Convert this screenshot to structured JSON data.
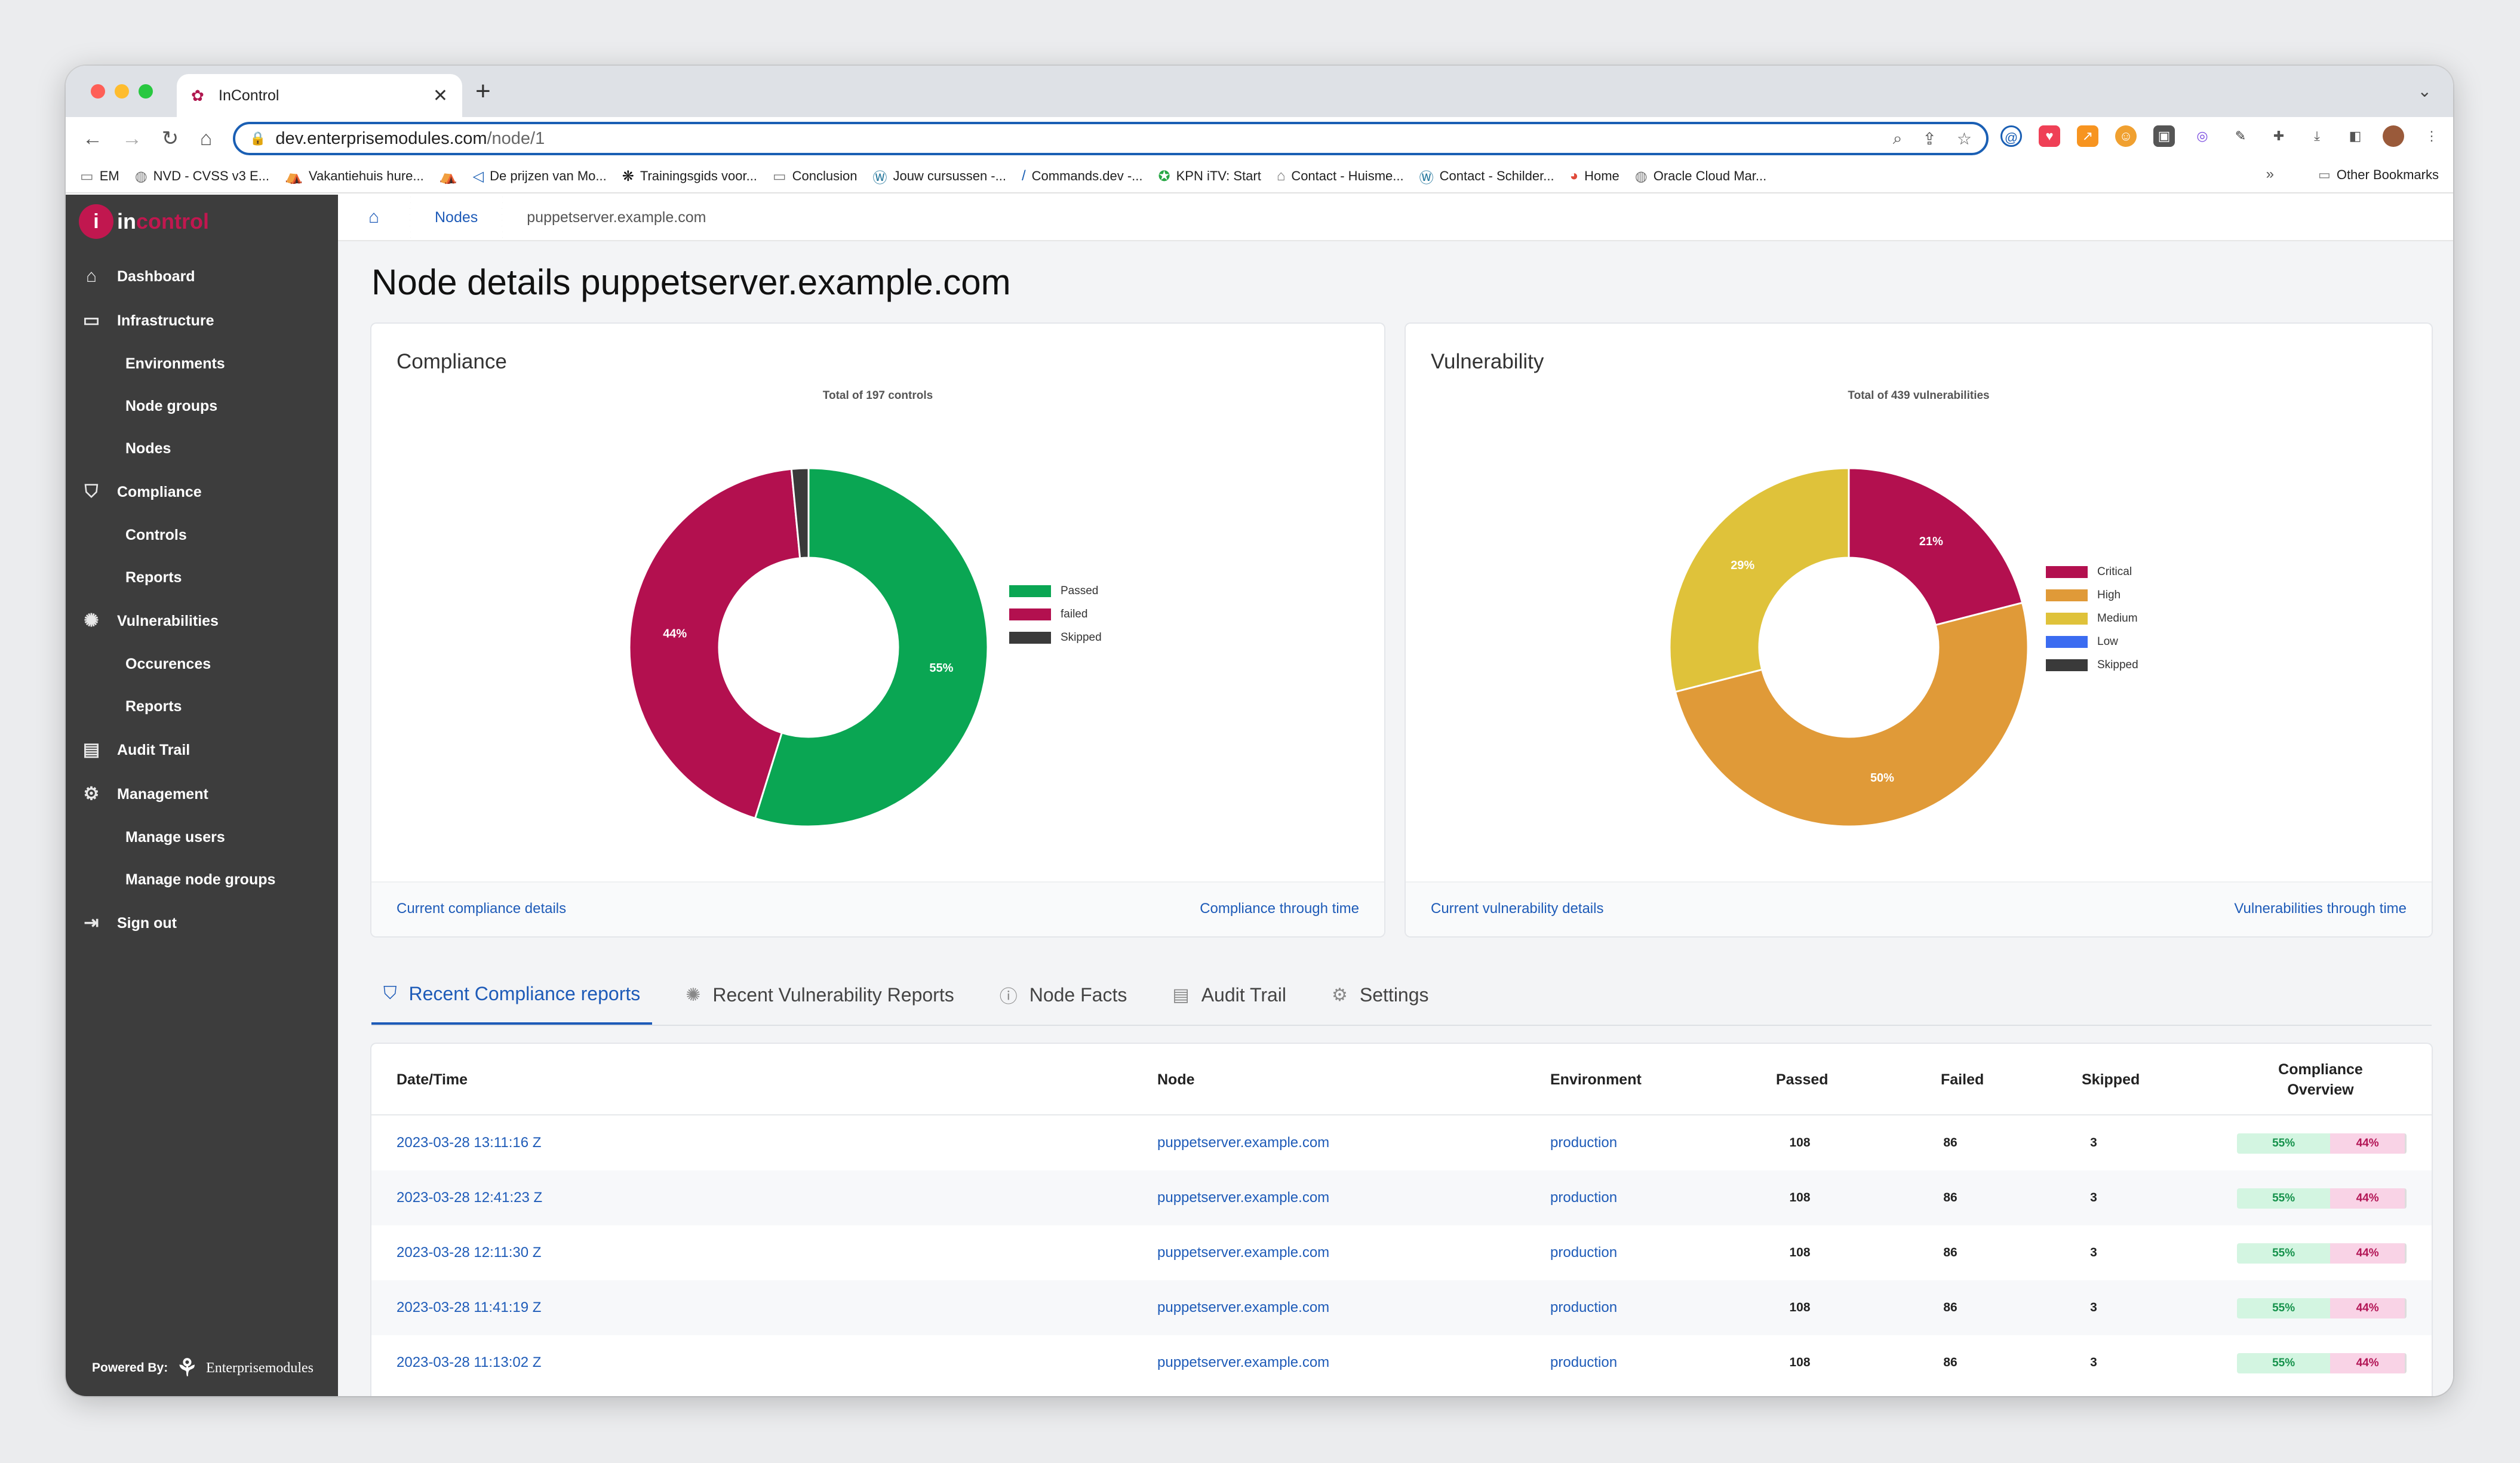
{
  "browser": {
    "tab_title": "InControl",
    "url_host": "dev.enterprisemodules.com",
    "url_path": "/node/1",
    "bookmarks": [
      "EM",
      "NVD - CVSS v3 E...",
      "Vakantiehuis hure...",
      "",
      "De prijzen van Mo...",
      "Trainingsgids voor...",
      "Conclusion",
      "Jouw cursussen -...",
      "Commands.dev -...",
      "KPN iTV: Start",
      "Contact - Huisme...",
      "Contact - Schilder...",
      "Home",
      "Oracle Cloud Mar..."
    ],
    "bookmarks_more": "»",
    "other_bookmarks": "Other Bookmarks"
  },
  "app": {
    "logo_in": "in",
    "logo_rest": "control",
    "nav": {
      "dashboard": "Dashboard",
      "infrastructure": "Infrastructure",
      "environments": "Environments",
      "node_groups": "Node groups",
      "nodes": "Nodes",
      "compliance": "Compliance",
      "controls": "Controls",
      "compliance_reports": "Reports",
      "vulnerabilities": "Vulnerabilities",
      "occurences": "Occurences",
      "vulnerability_reports": "Reports",
      "audit_trail": "Audit Trail",
      "management": "Management",
      "manage_users": "Manage users",
      "manage_node_groups": "Manage node groups",
      "sign_out": "Sign out"
    },
    "powered_by": "Powered By:",
    "powered_brand": "Enterprisemodules"
  },
  "breadcrumb": {
    "nodes": "Nodes",
    "current": "puppetserver.example.com"
  },
  "page_title": "Node details puppetserver.example.com",
  "compliance_card": {
    "title": "Compliance",
    "footer_left": "Current compliance details",
    "footer_right": "Compliance through time"
  },
  "vulnerability_card": {
    "title": "Vulnerability",
    "footer_left": "Current vulnerability details",
    "footer_right": "Vulnerabilities through time"
  },
  "chart_data": [
    {
      "type": "pie",
      "title": "Total of 197 controls",
      "categories": [
        "Passed",
        "failed",
        "Skipped"
      ],
      "values": [
        108,
        86,
        3
      ],
      "labels": [
        "55%",
        "44%",
        ""
      ],
      "colors": [
        "#0aa653",
        "#b3104f",
        "#3a3a3a"
      ],
      "legend": "right"
    },
    {
      "type": "pie",
      "title": "Total of 439 vulnerabilities",
      "categories": [
        "Critical",
        "High",
        "Medium",
        "Low",
        "Skipped"
      ],
      "values": [
        21,
        50,
        29,
        0,
        0
      ],
      "labels": [
        "21%",
        "50%",
        "29%",
        "",
        ""
      ],
      "colors": [
        "#b3104f",
        "#e09a38",
        "#dfc23a",
        "#3b6cf1",
        "#3a3a3a"
      ],
      "legend": "right"
    }
  ],
  "tabs": [
    "Recent Compliance reports",
    "Recent Vulnerability Reports",
    "Node Facts",
    "Audit Trail",
    "Settings"
  ],
  "table": {
    "headers": {
      "datetime": "Date/Time",
      "node": "Node",
      "environment": "Environment",
      "passed": "Passed",
      "failed": "Failed",
      "skipped": "Skipped",
      "overview_1": "Compliance",
      "overview_2": "Overview"
    },
    "rows": [
      {
        "datetime": "2023-03-28 13:11:16 Z",
        "node": "puppetserver.example.com",
        "environment": "production",
        "passed": "108",
        "failed": "86",
        "skipped": "3",
        "pct_passed": "55%",
        "pct_failed": "44%"
      },
      {
        "datetime": "2023-03-28 12:41:23 Z",
        "node": "puppetserver.example.com",
        "environment": "production",
        "passed": "108",
        "failed": "86",
        "skipped": "3",
        "pct_passed": "55%",
        "pct_failed": "44%"
      },
      {
        "datetime": "2023-03-28 12:11:30 Z",
        "node": "puppetserver.example.com",
        "environment": "production",
        "passed": "108",
        "failed": "86",
        "skipped": "3",
        "pct_passed": "55%",
        "pct_failed": "44%"
      },
      {
        "datetime": "2023-03-28 11:41:19 Z",
        "node": "puppetserver.example.com",
        "environment": "production",
        "passed": "108",
        "failed": "86",
        "skipped": "3",
        "pct_passed": "55%",
        "pct_failed": "44%"
      },
      {
        "datetime": "2023-03-28 11:13:02 Z",
        "node": "puppetserver.example.com",
        "environment": "production",
        "passed": "108",
        "failed": "86",
        "skipped": "3",
        "pct_passed": "55%",
        "pct_failed": "44%"
      }
    ]
  }
}
